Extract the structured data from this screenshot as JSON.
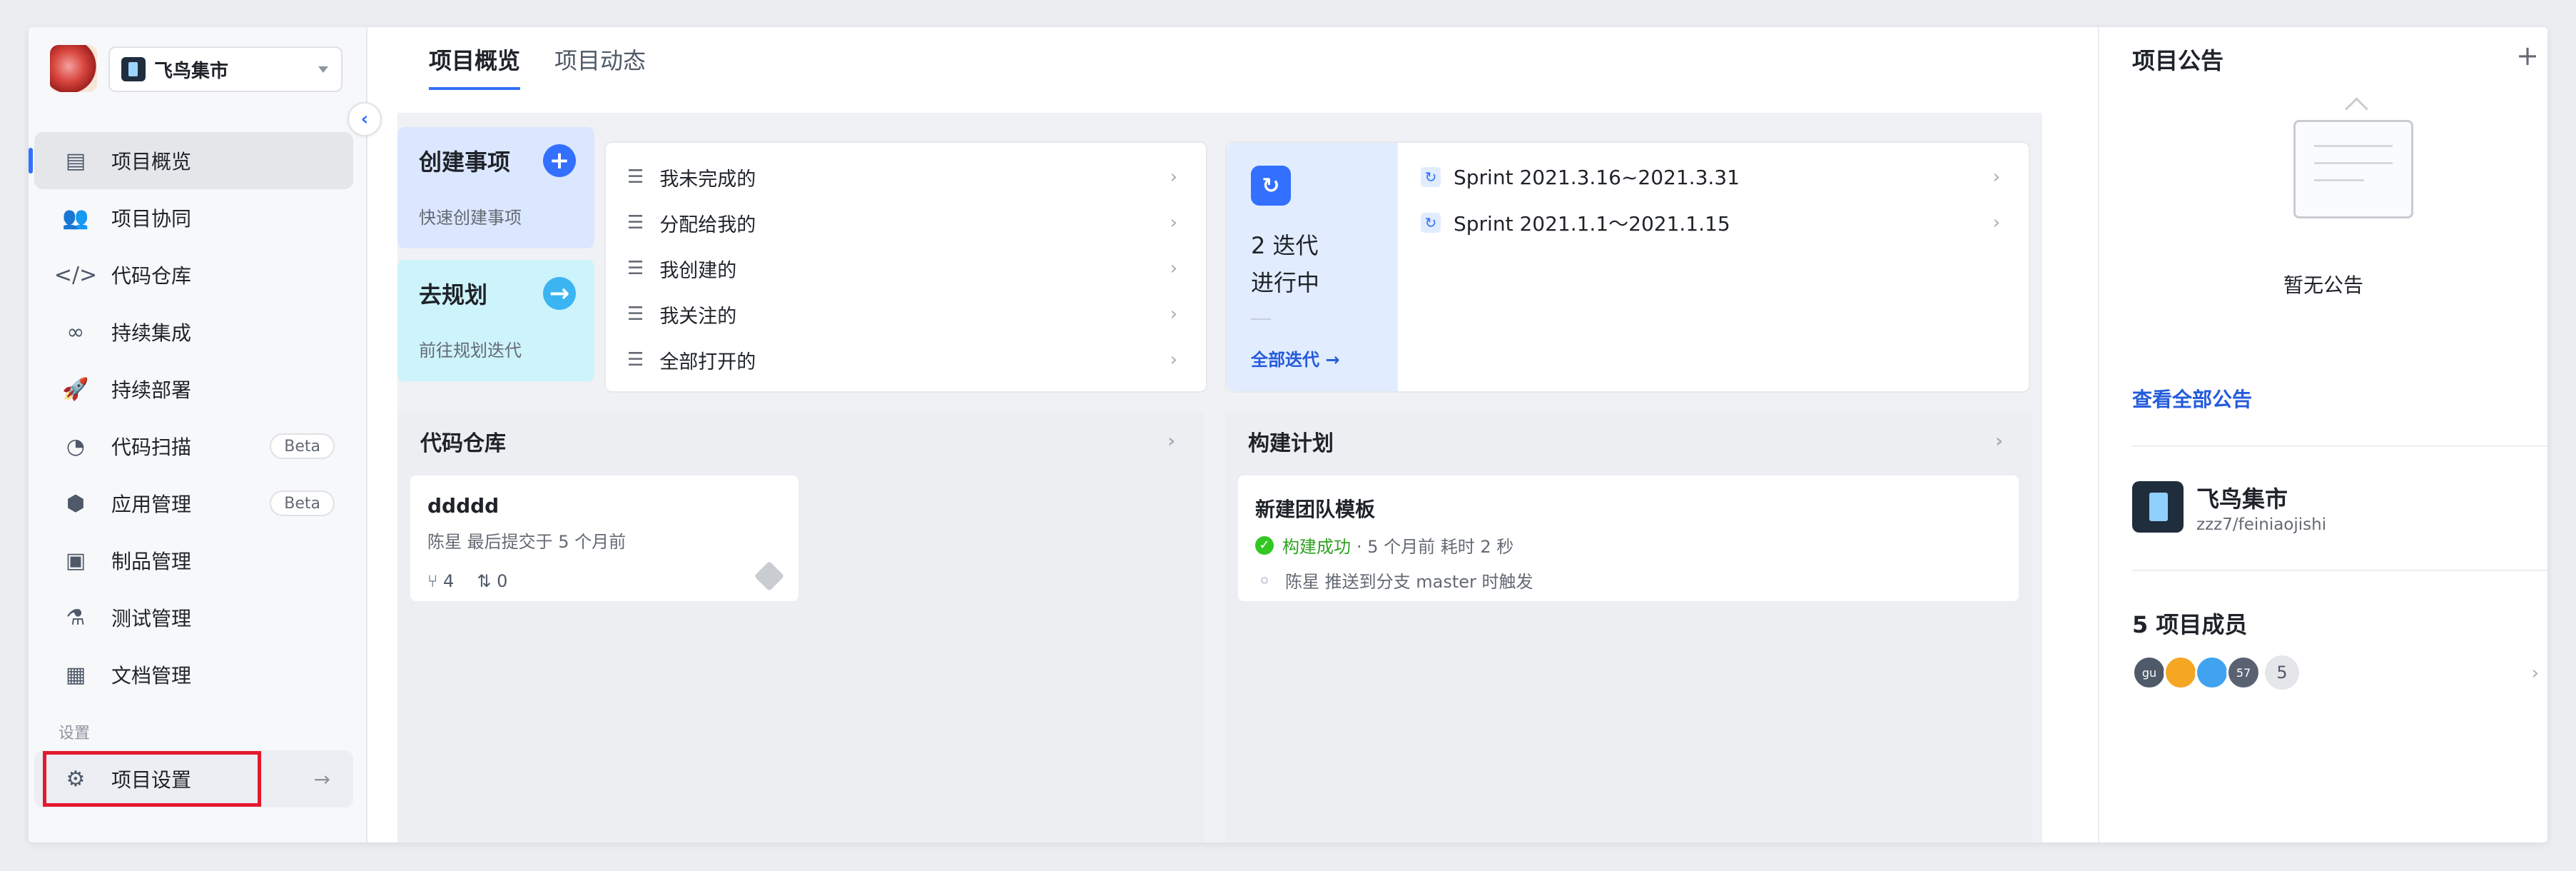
{
  "project": {
    "name": "飞鸟集市",
    "path": "zzz7/feiniaojishi"
  },
  "sidebar": {
    "items": [
      {
        "label": "项目概览",
        "icon": "overview-icon",
        "glyph": "▤",
        "active": true
      },
      {
        "label": "项目协同",
        "icon": "team-icon",
        "glyph": "👥"
      },
      {
        "label": "代码仓库",
        "icon": "code-icon",
        "glyph": "</>"
      },
      {
        "label": "持续集成",
        "icon": "infinity-icon",
        "glyph": "∞"
      },
      {
        "label": "持续部署",
        "icon": "rocket-icon",
        "glyph": "🚀"
      },
      {
        "label": "代码扫描",
        "icon": "pie-icon",
        "glyph": "◔",
        "badge": "Beta"
      },
      {
        "label": "应用管理",
        "icon": "cube-icon",
        "glyph": "⬢",
        "badge": "Beta"
      },
      {
        "label": "制品管理",
        "icon": "box-icon",
        "glyph": "▣"
      },
      {
        "label": "测试管理",
        "icon": "flask-icon",
        "glyph": "⚗"
      },
      {
        "label": "文档管理",
        "icon": "document-icon",
        "glyph": "▦"
      }
    ],
    "section_settings": "设置",
    "settings_label": "项目设置"
  },
  "tabs": [
    "项目概览",
    "项目动态"
  ],
  "actions": {
    "create": {
      "title": "创建事项",
      "subtitle": "快速创建事项"
    },
    "plan": {
      "title": "去规划",
      "subtitle": "前往规划迭代"
    }
  },
  "filters": [
    "我未完成的",
    "分配给我的",
    "我创建的",
    "我关注的",
    "全部打开的"
  ],
  "iterations": {
    "line1": "2 迭代",
    "line2": "进行中",
    "link": "全部迭代 →",
    "sprints": [
      "Sprint 2021.3.16~2021.3.31",
      "Sprint 2021.1.1～2021.1.15"
    ]
  },
  "repo_panel": {
    "title": "代码仓库",
    "repo": {
      "name": "ddddd",
      "sub": "陈星 最后提交于 5 个月前",
      "branches": "4",
      "mrs": "0"
    }
  },
  "build_panel": {
    "title": "构建计划",
    "build": {
      "name": "新建团队模板",
      "status": "构建成功",
      "meta": "· 5 个月前  耗时 2 秒",
      "trigger": "陈星 推送到分支 master 时触发"
    }
  },
  "announcements": {
    "title": "项目公告",
    "empty": "暂无公告",
    "view_all": "查看全部公告"
  },
  "members": {
    "title": "5 项目成员",
    "avatars": [
      {
        "label": "gu",
        "color": "#4e5969"
      },
      {
        "label": "",
        "color": "#f5a623"
      },
      {
        "label": "",
        "color": "#3fa3f0"
      },
      {
        "label": "57",
        "color": "#5a6272"
      }
    ],
    "count": "5"
  },
  "colors": {
    "accent": "#3370ff",
    "success": "#34c724",
    "highlight": "#e5192d"
  }
}
